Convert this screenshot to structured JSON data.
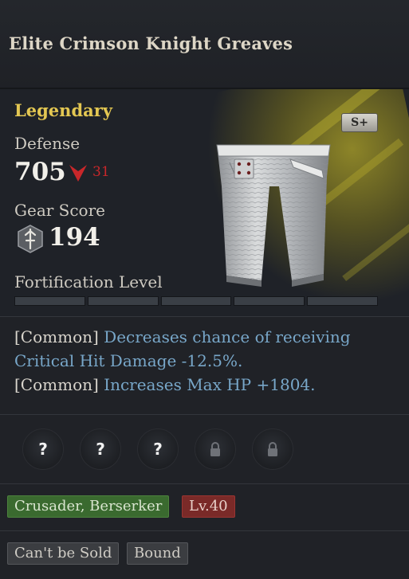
{
  "item": {
    "name": "Elite Crimson Knight Greaves"
  },
  "hero": {
    "rarity": "Legendary",
    "tier_badge": "S+",
    "defense_label": "Defense",
    "defense_value": "705",
    "defense_diff": "31",
    "gear_score_label": "Gear Score",
    "gear_score_value": "194",
    "fortification_label": "Fortification Level",
    "fortification_segments": 5,
    "fortification_filled": 0
  },
  "effects": [
    {
      "tag": "[Common]",
      "text_1": "Decreases chance of receiving",
      "text_2": "Critical Hit Damage -12.5%."
    },
    {
      "tag": "[Common]",
      "text": "Increases Max HP +1804."
    }
  ],
  "sockets": [
    {
      "state": "unknown",
      "glyph": "?"
    },
    {
      "state": "unknown",
      "glyph": "?"
    },
    {
      "state": "unknown",
      "glyph": "?"
    },
    {
      "state": "locked",
      "icon": "lock-icon"
    },
    {
      "state": "locked",
      "icon": "lock-icon"
    }
  ],
  "tags": {
    "classes": "Crusader, Berserker",
    "level": "Lv.40"
  },
  "flags": [
    "Can't be Sold",
    "Bound"
  ],
  "colors": {
    "rarity": "#e3c752",
    "effect_text": "#78a7c9",
    "decrease": "#c8272a",
    "class_tag": "#3a6a2f",
    "level_tag": "#7a2a28"
  }
}
